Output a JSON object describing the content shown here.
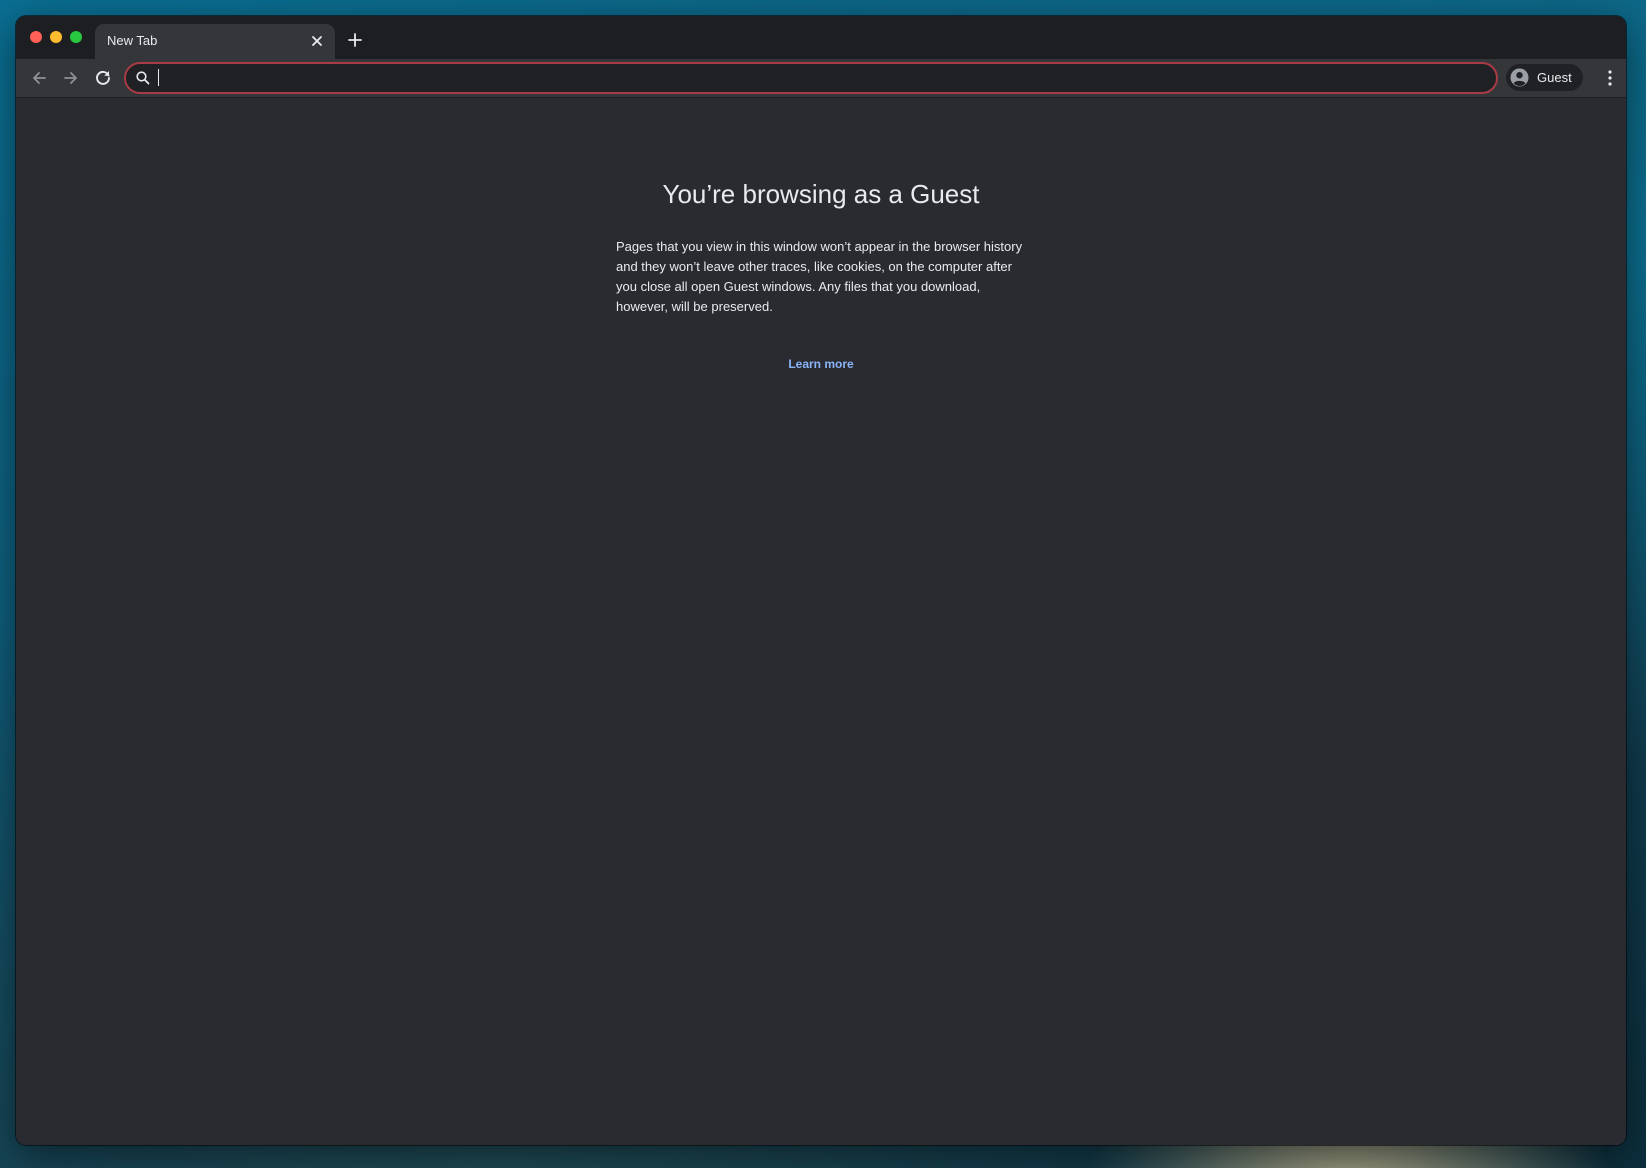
{
  "browser": {
    "tab": {
      "title": "New Tab"
    },
    "omnibox": {
      "value": "",
      "placeholder": ""
    },
    "profile": {
      "label": "Guest"
    }
  },
  "page": {
    "title": "You’re browsing as a Guest",
    "body": "Pages that you view in this window won’t appear in the browser history and they won’t leave other traces, like cookies, on the computer after you close all open Guest windows. Any files that you download, however, will be preserved.",
    "learn_more": "Learn more"
  },
  "icons": {
    "traffic_lights": [
      "close-window",
      "minimize-window",
      "maximize-window"
    ],
    "tab_close": "close-icon",
    "new_tab": "plus-icon",
    "nav": [
      "back-arrow-icon",
      "forward-arrow-icon",
      "reload-icon"
    ],
    "omnibox": "search-icon",
    "profile": "account-circle-icon",
    "menu": "more-vertical-icon"
  },
  "colors": {
    "accent_link": "#8ab4f8",
    "omnibox_focus": "#a83b45",
    "content_background": "#2a2b30"
  }
}
